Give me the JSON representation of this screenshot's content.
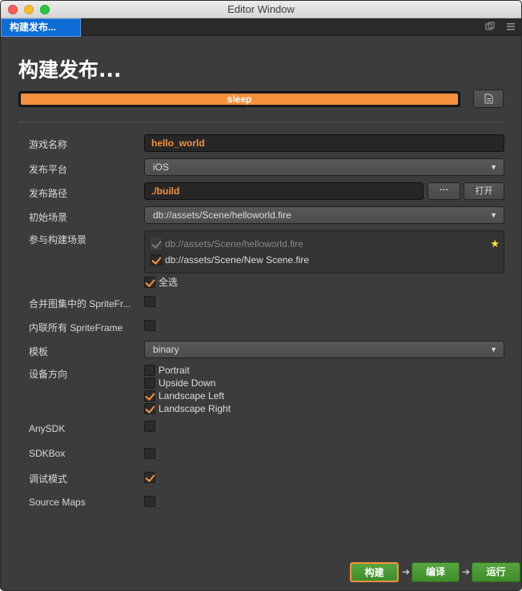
{
  "window": {
    "title": "Editor Window"
  },
  "tab": {
    "label": "构建发布..."
  },
  "panel": {
    "heading": "构建发布...",
    "progress": {
      "status": "sleep",
      "fraction": 1.0
    },
    "fields": {
      "game_name": {
        "label": "游戏名称",
        "value": "hello_world"
      },
      "platform": {
        "label": "发布平台",
        "value": "iOS"
      },
      "build_path": {
        "label": "发布路径",
        "value": "./build",
        "browse_label": "···",
        "open_label": "打开"
      },
      "start_scene": {
        "label": "初始场景",
        "value": "db://assets/Scene/helloworld.fire"
      },
      "included_scenes": {
        "label": "参与构建场景",
        "scenes": [
          {
            "path": "db://assets/Scene/helloworld.fire",
            "checked": true,
            "disabled": true
          },
          {
            "path": "db://assets/Scene/New Scene.fire",
            "checked": true,
            "disabled": false
          }
        ],
        "select_all": {
          "label": "全选",
          "checked": true
        }
      },
      "merge_atlas": {
        "label": "合并图集中的 SpriteFr...",
        "checked": false
      },
      "inline_spriteframe": {
        "label": "内联所有 SpriteFrame",
        "checked": false
      },
      "template": {
        "label": "模板",
        "value": "binary"
      },
      "orientation": {
        "label": "设备方向",
        "options": [
          {
            "label": "Portrait",
            "checked": false
          },
          {
            "label": "Upside Down",
            "checked": false
          },
          {
            "label": "Landscape Left",
            "checked": true
          },
          {
            "label": "Landscape Right",
            "checked": true
          }
        ]
      },
      "anysdk": {
        "label": "AnySDK",
        "checked": false
      },
      "sdkbox": {
        "label": "SDKBox",
        "checked": false
      },
      "debug": {
        "label": "调试模式",
        "checked": true
      },
      "source_maps": {
        "label": "Source Maps",
        "checked": false
      }
    },
    "actions": {
      "build": "构建",
      "compile": "编译",
      "run": "运行"
    }
  },
  "colors": {
    "accent": "#f7913d",
    "tab_active": "#0e6dd6",
    "action_green": "#4a9a34",
    "background": "#3c3c3c"
  }
}
